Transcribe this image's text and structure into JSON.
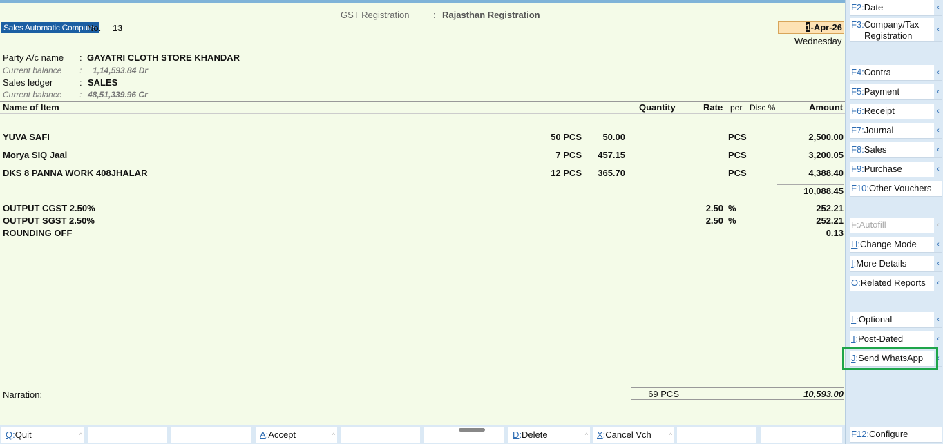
{
  "header": {
    "gst_label": "GST Registration",
    "gst_colon": ":",
    "gst_value": "Rajasthan Registration"
  },
  "voucher": {
    "type": "Sales Automatic Computer",
    "no_label": "No.",
    "no": "13",
    "date_cursor": "1",
    "date_rest": "-Apr-26",
    "day": "Wednesday"
  },
  "party": {
    "label": "Party A/c name",
    "colon": ":",
    "value": "GAYATRI CLOTH STORE KHANDAR",
    "balance_label": "Current balance",
    "balance_colon": ":",
    "balance": "1,14,593.84 Dr"
  },
  "sales_ledger": {
    "label": "Sales ledger",
    "colon": ":",
    "value": "SALES",
    "balance_label": "Current balance",
    "balance_colon": ":",
    "balance": "48,51,339.96 Cr"
  },
  "columns": {
    "name": "Name of Item",
    "quantity": "Quantity",
    "rate": "Rate",
    "per": "per",
    "disc": "Disc %",
    "amount": "Amount"
  },
  "items": [
    {
      "name": "YUVA SAFI",
      "qty": "50 PCS",
      "rate": "50.00",
      "per": "PCS",
      "amount": "2,500.00"
    },
    {
      "name": "Morya SIQ Jaal",
      "qty": "7 PCS",
      "rate": "457.15",
      "per": "PCS",
      "amount": "3,200.05"
    },
    {
      "name": "DKS 8 PANNA WORK 408JHALAR",
      "qty": "12 PCS",
      "rate": "365.70",
      "per": "PCS",
      "amount": "4,388.40"
    }
  ],
  "subtotal": "10,088.45",
  "ledgers": [
    {
      "name": "OUTPUT CGST 2.50%",
      "rate": "2.50",
      "per": "%",
      "amount": "252.21"
    },
    {
      "name": "OUTPUT SGST 2.50%",
      "rate": "2.50",
      "per": "%",
      "amount": "252.21"
    },
    {
      "name": "ROUNDING OFF",
      "rate": "",
      "per": "",
      "amount": "0.13"
    }
  ],
  "footer": {
    "narration_label": "Narration:",
    "total_qty": "69 PCS",
    "total_amount": "10,593.00"
  },
  "sidebar": {
    "buttons": [
      {
        "key": "F2",
        "label": "Date"
      },
      {
        "key": "F3",
        "label": "Company/Tax",
        "label2": "Registration"
      },
      {
        "key": "F4",
        "label": "Contra"
      },
      {
        "key": "F5",
        "label": "Payment"
      },
      {
        "key": "F6",
        "label": "Receipt"
      },
      {
        "key": "F7",
        "label": "Journal"
      },
      {
        "key": "F8",
        "label": "Sales"
      },
      {
        "key": "F9",
        "label": "Purchase"
      },
      {
        "key": "F10",
        "label": "Other Vouchers"
      },
      {
        "key": "F",
        "label": "Autofill"
      },
      {
        "key": "H",
        "label": "Change Mode"
      },
      {
        "key": "I",
        "label": "More Details"
      },
      {
        "key": "O",
        "label": "Related Reports"
      },
      {
        "key": "L",
        "label": "Optional"
      },
      {
        "key": "T",
        "label": "Post-Dated"
      },
      {
        "key": "J",
        "label": "Send WhatsApp"
      },
      {
        "key": "F12",
        "label": "Configure"
      }
    ],
    "arrow": "‹",
    "colon": ":"
  },
  "bottombar": {
    "quit": {
      "key": "Q",
      "label": "Quit"
    },
    "accept": {
      "key": "A",
      "label": "Accept"
    },
    "delete": {
      "key": "D",
      "label": "Delete"
    },
    "cancel": {
      "key": "X",
      "label": "Cancel Vch"
    },
    "caret": "^"
  },
  "colors": {
    "main_bg": "#f4fbe8",
    "sidebar_bg": "#dbe9f5",
    "accent": "#1b5fa3",
    "date_bg": "#fde2b4",
    "highlight": "#1fa54a"
  }
}
